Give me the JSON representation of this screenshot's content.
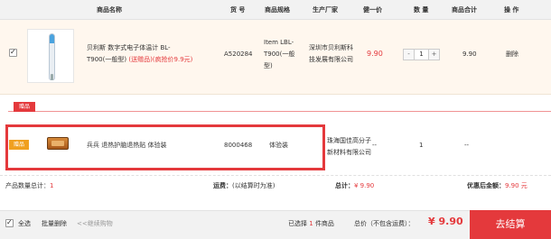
{
  "header": {
    "name": "商品名称",
    "code": "货 号",
    "spec": "商品规格",
    "maker": "生产厂家",
    "price": "健一价",
    "qty": "数 量",
    "total": "商品合计",
    "op": "操 作"
  },
  "item": {
    "name_line1": "贝利斯 数字式电子体温计 BL-",
    "name_line2": "T900(一般型)",
    "promo": "(送赠品)(疯抢价9.9元)",
    "code": "A520284",
    "spec_line1": "Item LBL-",
    "spec_line2": "T900(一般",
    "spec_line3": "型)",
    "maker_line1": "深圳市贝利斯科",
    "maker_line2": "技发展有限公司",
    "price": "9.90",
    "qty_minus": "-",
    "qty_value": "1",
    "qty_plus": "+",
    "subtotal": "9.90",
    "delete": "删除"
  },
  "gift": {
    "badge": "赠品",
    "tag": "赠品",
    "name": "兵兵 退热护脑退热贴 体验装",
    "code": "8000468",
    "spec": "体验装",
    "maker_line1": "珠海国佳高分子",
    "maker_line2": "新材料有限公司",
    "price": "--",
    "qty": "1",
    "subtotal": "--"
  },
  "summary": {
    "count_label": "产品数量总计：",
    "count_value": "1",
    "shipping_label": "运费：",
    "shipping_note": "(以结算时为准)",
    "total_label": "总计：",
    "total_value": "¥ 9.90",
    "discount_label": "优惠后金额：",
    "discount_value": "9.90 元"
  },
  "footer": {
    "select_all": "全选",
    "batch_delete": "批量删除",
    "continue": "<<继续购物",
    "selected_pre": "已选择",
    "selected_count": "1",
    "selected_post": "件商品",
    "total_label": "总价（不包含运费）：",
    "total_value": "¥ 9.90",
    "checkout": "去结算"
  },
  "colors": {
    "accent": "#e4393c",
    "row_bg": "#fff7ee",
    "header_bg": "#f2f2f2"
  }
}
